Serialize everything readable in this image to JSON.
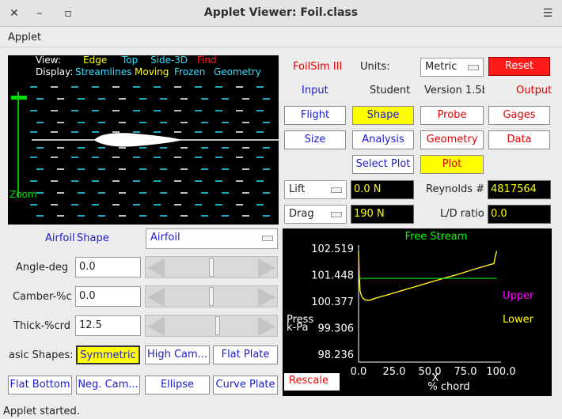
{
  "window": {
    "title": "Applet Viewer: Foil.class",
    "close": "✕",
    "minimize": "▫",
    "menu": "☰"
  },
  "menu": {
    "applet": "Applet"
  },
  "view": {
    "view_label": "View:",
    "edge": "Edge",
    "top": "Top",
    "side3d": "Side-3D",
    "find": "Find",
    "display_label": "Display:",
    "streamlines": "Streamlines",
    "moving": "Moving",
    "frozen": "Frozen",
    "geometry": "Geometry",
    "zoom": "Zoom"
  },
  "header": {
    "app_name": "FoilSim III",
    "units_label": "Units:",
    "units_value": "Metric",
    "reset": "Reset",
    "input": "Input",
    "student": "Student",
    "version": "Version 1.5b",
    "output": "Output"
  },
  "input_buttons": {
    "flight": "Flight",
    "shape": "Shape",
    "size": "Size",
    "analysis": "Analysis",
    "select_plot": "Select Plot"
  },
  "output_buttons": {
    "probe": "Probe",
    "gages": "Gages",
    "geometry": "Geometry",
    "data": "Data",
    "plot": "Plot"
  },
  "readouts": {
    "lift_choice": "Lift",
    "lift_value": "0.0 N",
    "drag_choice": "Drag",
    "drag_value": "190 N",
    "reynolds_label": "Reynolds #",
    "reynolds_value": "4817564",
    "ld_label": "L/D ratio",
    "ld_value": "0.0"
  },
  "shape_panel": {
    "airfoil_label": "Airfoil",
    "shape_label": "Shape",
    "airfoil_choice": "Airfoil",
    "angle_label": "Angle-deg",
    "angle_value": "0.0",
    "angle_level": 0.5,
    "camber_label": "Camber-%c",
    "camber_value": "0.0",
    "camber_level": 0.5,
    "thick_label": "Thick-%crd",
    "thick_value": "12.5",
    "thick_level": 0.57,
    "basic_shapes_label": "asic Shapes:",
    "symmetric": "Symmetric",
    "high_cam": "High Cam...",
    "flat_plate": "Flat Plate",
    "flat_bottom": "Flat Bottom",
    "neg_cam": "Neg. Cam...",
    "ellipse": "Ellipse",
    "curve_plate": "Curve Plate"
  },
  "plot": {
    "rescale": "Rescale"
  },
  "chart_data": {
    "type": "line",
    "title": "Free Stream",
    "xlabel": "X\n% chord",
    "ylabel": "Press\nk-Pa",
    "x_ticks": [
      "0.0",
      "25.0",
      "50.0",
      "75.0",
      "100.0"
    ],
    "y_ticks": [
      "102.519",
      "101.448",
      "100.377",
      "99.306",
      "98.236"
    ],
    "xlim": [
      0,
      100
    ],
    "ylim": [
      98.236,
      102.519
    ],
    "series": [
      {
        "name": "Upper",
        "color": "#ff00ff",
        "x": [
          0,
          0.3,
          1,
          2,
          3,
          5,
          8,
          12,
          20,
          30,
          40,
          50,
          60,
          70,
          80,
          90,
          95,
          96,
          97
        ],
        "y": [
          102.4,
          101.7,
          100.8,
          100.6,
          100.5,
          100.42,
          100.42,
          100.5,
          100.63,
          100.8,
          100.97,
          101.14,
          101.31,
          101.47,
          101.65,
          101.82,
          101.9,
          102.2,
          102.4
        ]
      },
      {
        "name": "Lower",
        "color": "#ffff00",
        "x": [
          0,
          0.3,
          1,
          2,
          3,
          5,
          8,
          12,
          20,
          30,
          40,
          50,
          60,
          70,
          80,
          90,
          95,
          96,
          97
        ],
        "y": [
          102.4,
          101.7,
          100.8,
          100.6,
          100.5,
          100.42,
          100.42,
          100.5,
          100.63,
          100.8,
          100.97,
          101.14,
          101.31,
          101.47,
          101.65,
          101.82,
          101.9,
          102.2,
          102.4
        ]
      },
      {
        "name": "Free Stream",
        "color": "#00ff00",
        "x": [
          0,
          97
        ],
        "y": [
          101.3,
          101.3
        ]
      }
    ]
  }
}
